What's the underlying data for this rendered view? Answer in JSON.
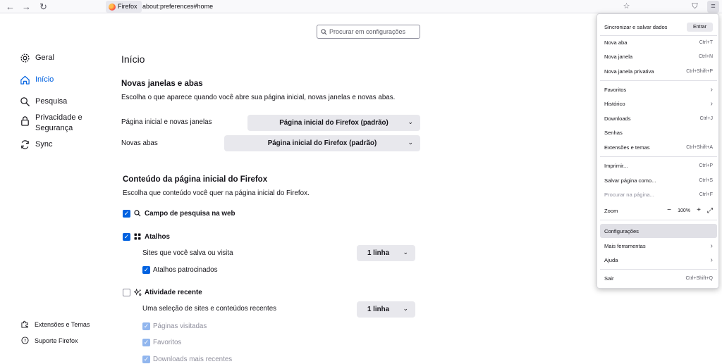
{
  "toolbar": {
    "back_icon": "←",
    "forward_icon": "→",
    "reload_icon": "↻",
    "identity_label": "Firefox",
    "url": "about:preferences#home",
    "bookmark_icon": "☆",
    "pocket_icon": "⛉",
    "extensions_icon": "⧉",
    "menu_icon": "≡"
  },
  "search": {
    "placeholder": "Procurar em configurações"
  },
  "sidebar": {
    "items": [
      {
        "label": "Geral"
      },
      {
        "label": "Início"
      },
      {
        "label": "Pesquisa"
      },
      {
        "label": "Privacidade e Segurança"
      },
      {
        "label": "Sync"
      }
    ],
    "footer": [
      {
        "label": "Extensões e Temas"
      },
      {
        "label": "Suporte Firefox"
      }
    ]
  },
  "main": {
    "title": "Início",
    "windows_section": {
      "heading": "Novas janelas e abas",
      "description": "Escolha o que aparece quando você abre sua página inicial, novas janelas e novas abas.",
      "homepage_label": "Página inicial e novas janelas",
      "homepage_value": "Página inicial do Firefox (padrão)",
      "newtabs_label": "Novas abas",
      "newtabs_value": "Página inicial do Firefox (padrão)"
    },
    "content_section": {
      "heading": "Conteúdo da página inicial do Firefox",
      "description": "Escolha que conteúdo você quer na página inicial do Firefox.",
      "websearch_label": "Campo de pesquisa na web",
      "shortcuts_label": "Atalhos",
      "shortcuts_rows_label": "Sites que você salva ou visita",
      "shortcuts_rows_value": "1 linha",
      "sponsored_label": "Atalhos patrocinados",
      "recent_label": "Atividade recente",
      "recent_rows_label": "Uma seleção de sites e conteúdos recentes",
      "recent_rows_value": "1 linha",
      "visited_label": "Páginas visitadas",
      "bookmarks_label": "Favoritos",
      "downloads_label": "Downloads mais recentes"
    }
  },
  "app_menu": {
    "sync_label": "Sincronizar e salvar dados",
    "signin_label": "Entrar",
    "items": [
      {
        "label": "Nova aba",
        "shortcut": "Ctrl+T"
      },
      {
        "label": "Nova janela",
        "shortcut": "Ctrl+N"
      },
      {
        "label": "Nova janela privativa",
        "shortcut": "Ctrl+Shift+P"
      },
      {
        "label": "Favoritos",
        "shortcut": ""
      },
      {
        "label": "Histórico",
        "shortcut": ""
      },
      {
        "label": "Downloads",
        "shortcut": "Ctrl+J"
      },
      {
        "label": "Senhas",
        "shortcut": ""
      },
      {
        "label": "Extensões e temas",
        "shortcut": "Ctrl+Shift+A"
      },
      {
        "label": "Imprimir...",
        "shortcut": "Ctrl+P"
      },
      {
        "label": "Salvar página como...",
        "shortcut": "Ctrl+S"
      },
      {
        "label": "Procurar na página...",
        "shortcut": "Ctrl+F"
      },
      {
        "label": "Zoom",
        "shortcut": ""
      },
      {
        "label": "Configurações",
        "shortcut": ""
      },
      {
        "label": "Mais ferramentas",
        "shortcut": ""
      },
      {
        "label": "Ajuda",
        "shortcut": ""
      },
      {
        "label": "Sair",
        "shortcut": "Ctrl+Shift+Q"
      }
    ],
    "zoom_level": "100%",
    "zoom_minus": "−",
    "zoom_plus": "+"
  },
  "colors": {
    "accent": "#0061e0",
    "menu_highlight": "#e0e0e6"
  }
}
